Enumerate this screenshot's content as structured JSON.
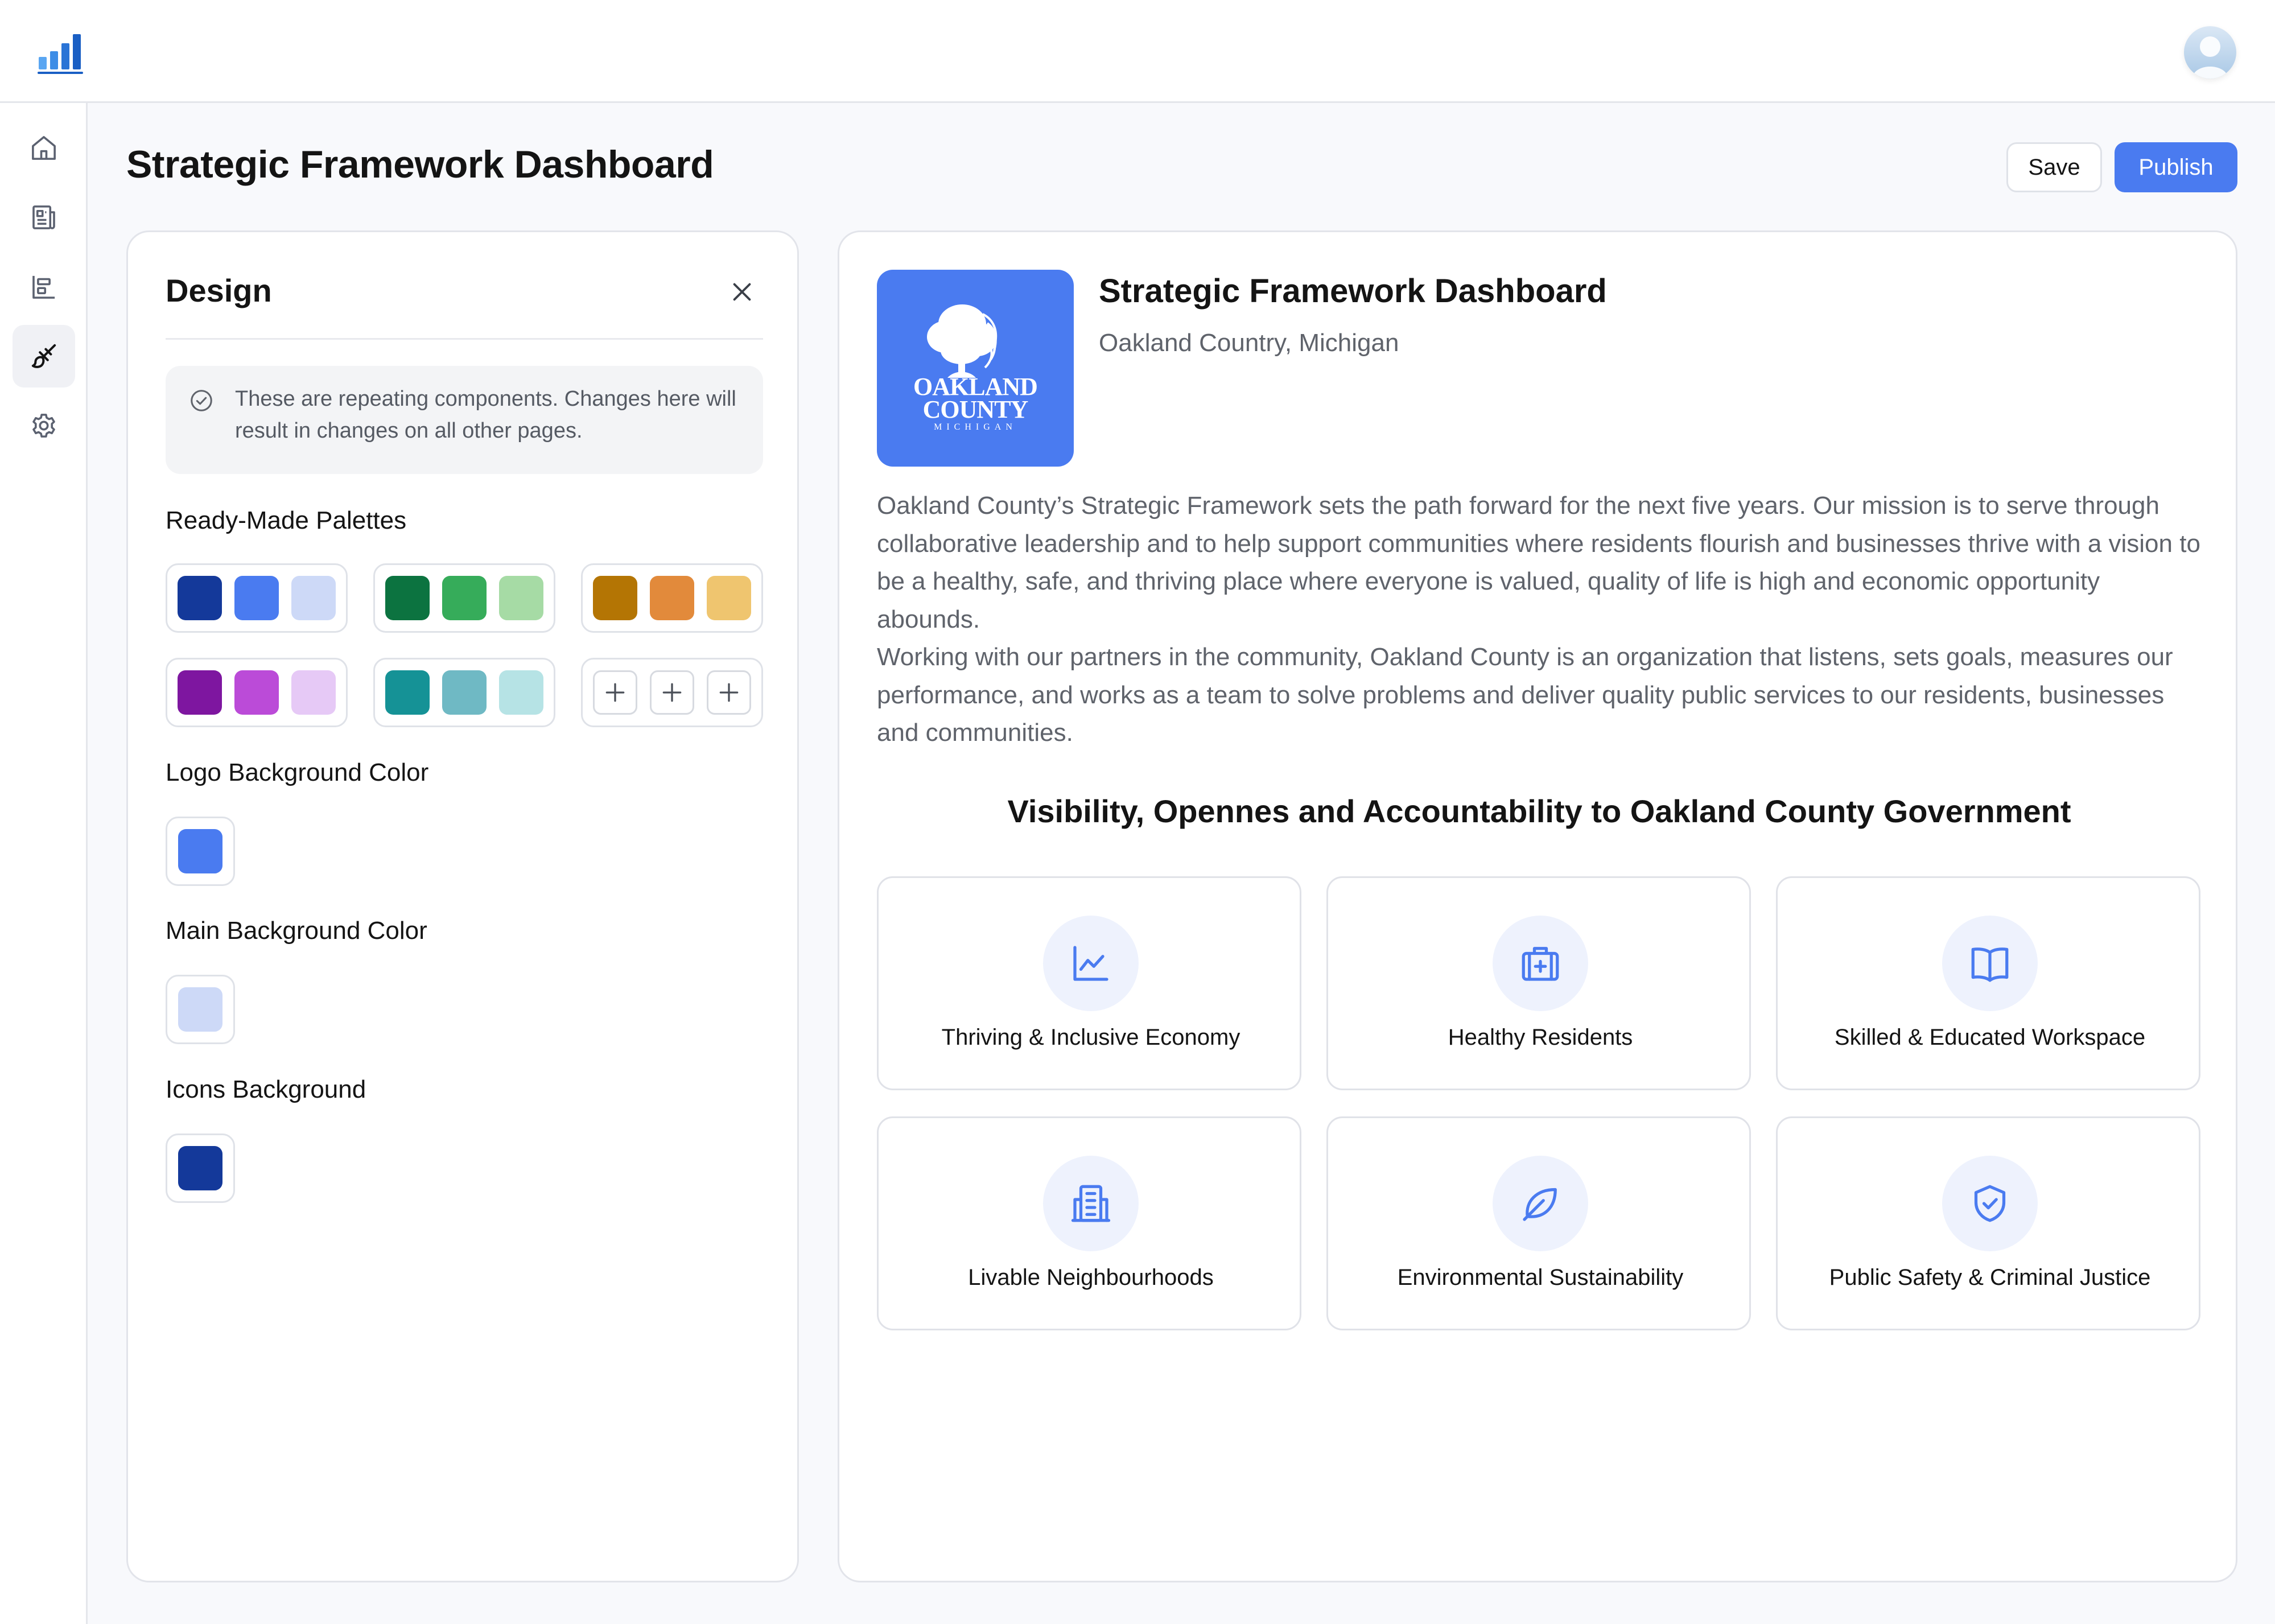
{
  "header": {
    "title": "Strategic Framework Dashboard",
    "save_label": "Save",
    "publish_label": "Publish"
  },
  "sidebar": {
    "items": [
      {
        "icon": "home-icon",
        "active": false
      },
      {
        "icon": "newspaper-icon",
        "active": false
      },
      {
        "icon": "layout-icon",
        "active": false
      },
      {
        "icon": "paintbrush-icon",
        "active": true
      },
      {
        "icon": "gear-icon",
        "active": false
      }
    ]
  },
  "design": {
    "title": "Design",
    "info": "These are repeating components. Changes here will result in changes on all other pages.",
    "palettes_label": "Ready-Made Palettes",
    "palettes": [
      [
        "#14399a",
        "#4a7bf0",
        "#cdd9f7"
      ],
      [
        "#0c7340",
        "#36ac5a",
        "#a6dba5"
      ],
      [
        "#b47504",
        "#e28a3b",
        "#efc56f"
      ],
      [
        "#7e16a0",
        "#bb4bd8",
        "#e6c9f6"
      ],
      [
        "#159296",
        "#6fb9c4",
        "#b6e3e5"
      ]
    ],
    "logo_bg_label": "Logo Background Color",
    "logo_bg_color": "#4a7bf0",
    "main_bg_label": "Main Background Color",
    "main_bg_color": "#cdd9f7",
    "icons_bg_label": "Icons Background",
    "icons_bg_color": "#14399a"
  },
  "preview": {
    "logo": {
      "line1": "OAKLAND",
      "line2": "COUNTY",
      "line3": "MICHIGAN"
    },
    "title": "Strategic Framework Dashboard",
    "subtitle": "Oakland Country, Michigan",
    "description_1": "Oakland County’s Strategic Framework sets the path forward for the next five years. Our mission is to serve through collaborative leadership and to help support communities where residents flourish and businesses thrive with a vision to be a healthy, safe, and thriving place where everyone is valued, quality of life is high and economic opportunity abounds.",
    "description_2": "Working with our partners in the community, Oakland County is an organization that listens, sets goals, measures our performance, and works as a team to solve problems and deliver quality public services to our residents, businesses and communities.",
    "section_heading": "Visibility, Opennes and Accountability to Oakland County Government",
    "cards": [
      {
        "label": "Thriving & Inclusive Economy",
        "icon": "line-chart-icon"
      },
      {
        "label": "Healthy Residents",
        "icon": "medical-bag-icon"
      },
      {
        "label": "Skilled & Educated Workspace",
        "icon": "open-book-icon"
      },
      {
        "label": "Livable Neighbourhoods",
        "icon": "building-icon"
      },
      {
        "label": "Environmental Sustainability",
        "icon": "leaf-icon"
      },
      {
        "label": "Public Safety & Criminal Justice",
        "icon": "shield-check-icon"
      }
    ],
    "accent_color": "#4a7bf0"
  }
}
